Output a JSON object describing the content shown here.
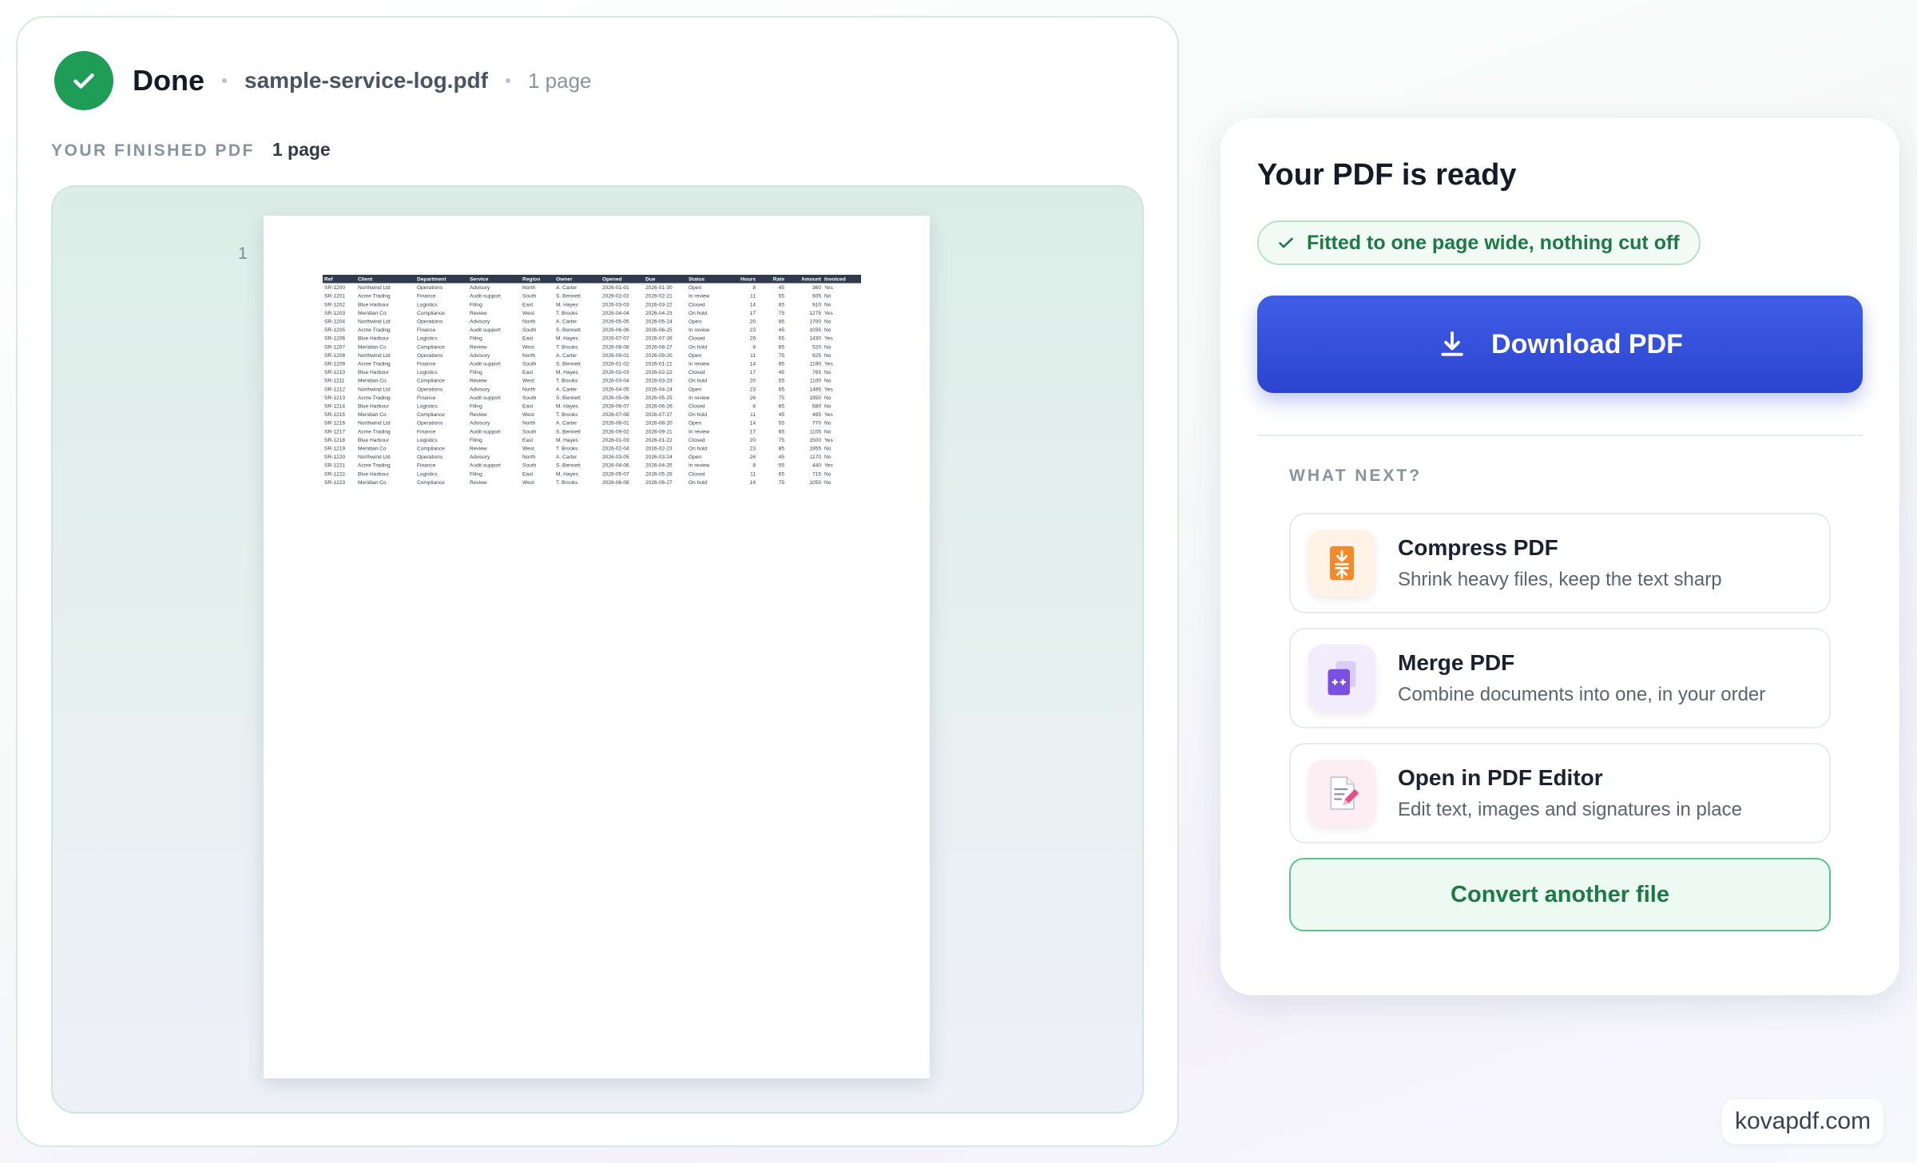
{
  "header": {
    "status": "Done",
    "file_name": "sample-service-log.pdf",
    "page_count": "1 page"
  },
  "preview": {
    "label": "YOUR FINISHED PDF",
    "count": "1 page",
    "page_number": "1",
    "table": {
      "columns": [
        "Ref",
        "Client",
        "Department",
        "Service",
        "Region",
        "Owner",
        "Opened",
        "Due",
        "Status",
        "Hours",
        "Rate",
        "Amount",
        "Invoiced"
      ],
      "rows": [
        [
          "SR-1200",
          "Northwind Ltd",
          "Operations",
          "Advisory",
          "North",
          "A. Carter",
          "2026-01-01",
          "2026-01-30",
          "Open",
          "8",
          "45",
          "360",
          "Yes"
        ],
        [
          "SR-1201",
          "Acme Trading",
          "Finance",
          "Audit support",
          "South",
          "S. Bennett",
          "2026-02-02",
          "2026-02-21",
          "In review",
          "11",
          "55",
          "605",
          "No"
        ],
        [
          "SR-1202",
          "Blue Harbour",
          "Logistics",
          "Filing",
          "East",
          "M. Hayes",
          "2026-03-03",
          "2026-03-22",
          "Closed",
          "14",
          "65",
          "910",
          "No"
        ],
        [
          "SR-1203",
          "Meridian Co",
          "Compliance",
          "Review",
          "West",
          "T. Brooks",
          "2026-04-04",
          "2026-04-23",
          "On hold",
          "17",
          "75",
          "1275",
          "Yes"
        ],
        [
          "SR-1204",
          "Northwind Ltd",
          "Operations",
          "Advisory",
          "North",
          "A. Carter",
          "2026-05-05",
          "2026-05-24",
          "Open",
          "20",
          "85",
          "1700",
          "No"
        ],
        [
          "SR-1205",
          "Acme Trading",
          "Finance",
          "Audit support",
          "South",
          "S. Bennett",
          "2026-06-06",
          "2026-06-25",
          "In review",
          "23",
          "45",
          "1035",
          "No"
        ],
        [
          "SR-1206",
          "Blue Harbour",
          "Logistics",
          "Filing",
          "East",
          "M. Hayes",
          "2026-07-07",
          "2026-07-26",
          "Closed",
          "26",
          "55",
          "1430",
          "Yes"
        ],
        [
          "SR-1207",
          "Meridian Co",
          "Compliance",
          "Review",
          "West",
          "T. Brooks",
          "2026-08-08",
          "2026-08-27",
          "On hold",
          "8",
          "65",
          "520",
          "No"
        ],
        [
          "SR-1208",
          "Northwind Ltd",
          "Operations",
          "Advisory",
          "North",
          "A. Carter",
          "2026-09-01",
          "2026-09-20",
          "Open",
          "11",
          "75",
          "825",
          "No"
        ],
        [
          "SR-1209",
          "Acme Trading",
          "Finance",
          "Audit support",
          "South",
          "S. Bennett",
          "2026-01-02",
          "2026-01-21",
          "In review",
          "14",
          "85",
          "1190",
          "Yes"
        ],
        [
          "SR-1210",
          "Blue Harbour",
          "Logistics",
          "Filing",
          "East",
          "M. Hayes",
          "2026-02-03",
          "2026-02-22",
          "Closed",
          "17",
          "45",
          "765",
          "No"
        ],
        [
          "SR-1211",
          "Meridian Co",
          "Compliance",
          "Review",
          "West",
          "T. Brooks",
          "2026-03-04",
          "2026-03-23",
          "On hold",
          "20",
          "55",
          "1100",
          "No"
        ],
        [
          "SR-1212",
          "Northwind Ltd",
          "Operations",
          "Advisory",
          "North",
          "A. Carter",
          "2026-04-05",
          "2026-04-24",
          "Open",
          "23",
          "65",
          "1495",
          "Yes"
        ],
        [
          "SR-1213",
          "Acme Trading",
          "Finance",
          "Audit support",
          "South",
          "S. Bennett",
          "2026-05-06",
          "2026-05-25",
          "In review",
          "26",
          "75",
          "1950",
          "No"
        ],
        [
          "SR-1214",
          "Blue Harbour",
          "Logistics",
          "Filing",
          "East",
          "M. Hayes",
          "2026-06-07",
          "2026-06-26",
          "Closed",
          "8",
          "85",
          "680",
          "No"
        ],
        [
          "SR-1215",
          "Meridian Co",
          "Compliance",
          "Review",
          "West",
          "T. Brooks",
          "2026-07-08",
          "2026-07-27",
          "On hold",
          "11",
          "45",
          "495",
          "Yes"
        ],
        [
          "SR-1216",
          "Northwind Ltd",
          "Operations",
          "Advisory",
          "North",
          "A. Carter",
          "2026-08-01",
          "2026-08-20",
          "Open",
          "14",
          "55",
          "770",
          "No"
        ],
        [
          "SR-1217",
          "Acme Trading",
          "Finance",
          "Audit support",
          "South",
          "S. Bennett",
          "2026-09-02",
          "2026-09-21",
          "In review",
          "17",
          "65",
          "1105",
          "No"
        ],
        [
          "SR-1218",
          "Blue Harbour",
          "Logistics",
          "Filing",
          "East",
          "M. Hayes",
          "2026-01-03",
          "2026-01-22",
          "Closed",
          "20",
          "75",
          "1500",
          "Yes"
        ],
        [
          "SR-1219",
          "Meridian Co",
          "Compliance",
          "Review",
          "West",
          "T. Brooks",
          "2026-02-04",
          "2026-02-23",
          "On hold",
          "23",
          "85",
          "1955",
          "No"
        ],
        [
          "SR-1220",
          "Northwind Ltd",
          "Operations",
          "Advisory",
          "North",
          "A. Carter",
          "2026-03-05",
          "2026-03-24",
          "Open",
          "26",
          "45",
          "1170",
          "No"
        ],
        [
          "SR-1221",
          "Acme Trading",
          "Finance",
          "Audit support",
          "South",
          "S. Bennett",
          "2026-04-06",
          "2026-04-25",
          "In review",
          "8",
          "55",
          "440",
          "Yes"
        ],
        [
          "SR-1222",
          "Blue Harbour",
          "Logistics",
          "Filing",
          "East",
          "M. Hayes",
          "2026-05-07",
          "2026-05-26",
          "Closed",
          "11",
          "65",
          "715",
          "No"
        ],
        [
          "SR-1223",
          "Meridian Co",
          "Compliance",
          "Review",
          "West",
          "T. Brooks",
          "2026-06-08",
          "2026-06-27",
          "On hold",
          "14",
          "75",
          "1050",
          "No"
        ]
      ]
    }
  },
  "ready_card": {
    "title": "Your PDF is ready",
    "fit_badge": "Fitted to one page wide, nothing cut off",
    "download_label": "Download PDF",
    "what_next_label": "WHAT NEXT?",
    "actions": [
      {
        "title": "Compress PDF",
        "desc": "Shrink heavy files, keep the text sharp",
        "icon": "compress-icon"
      },
      {
        "title": "Merge PDF",
        "desc": "Combine documents into one, in your order",
        "icon": "merge-icon"
      },
      {
        "title": "Open in PDF Editor",
        "desc": "Edit text, images and signatures in place",
        "icon": "editor-icon"
      }
    ],
    "convert_label": "Convert another file"
  },
  "brand": "kovapdf.com",
  "colors": {
    "success_green": "#1f9d57",
    "primary_blue": "#3350dc",
    "table_header": "#2f3a4d"
  }
}
